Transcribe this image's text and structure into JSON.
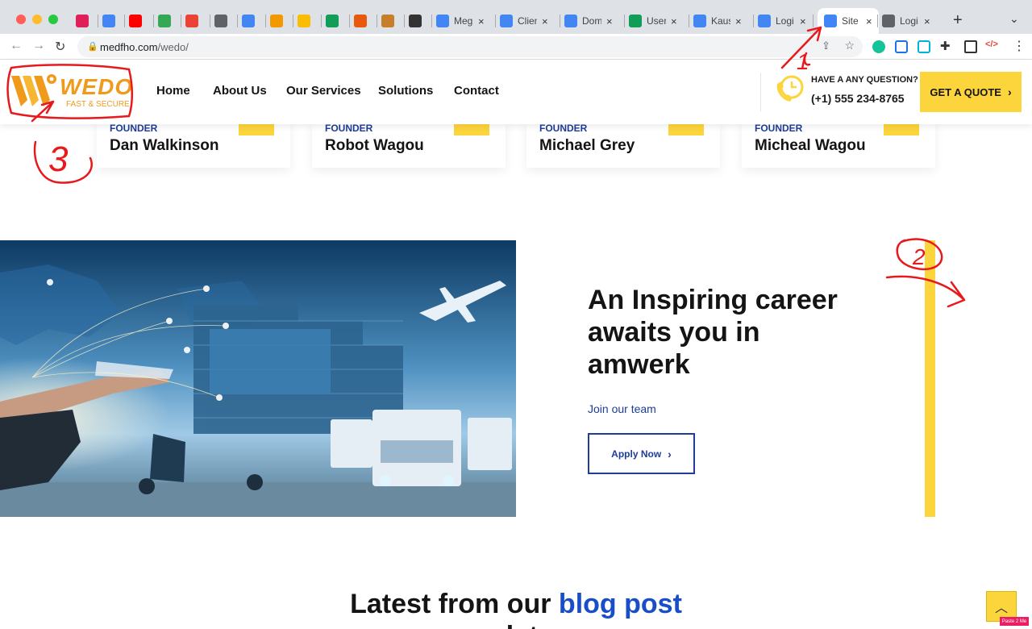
{
  "browser": {
    "tabs": [
      {
        "label": "",
        "icon": "slack-icon",
        "color": "#e01e5a"
      },
      {
        "label": "",
        "icon": "docs-icon",
        "color": "#4285f4"
      },
      {
        "label": "",
        "icon": "youtube-icon",
        "color": "#ff0000"
      },
      {
        "label": "",
        "icon": "calendar-icon",
        "color": "#34a853"
      },
      {
        "label": "",
        "icon": "gmail-icon",
        "color": "#ea4335"
      },
      {
        "label": "",
        "icon": "app-icon",
        "color": "#5f6368"
      },
      {
        "label": "",
        "icon": "docs-icon",
        "color": "#4285f4"
      },
      {
        "label": "",
        "icon": "app-icon",
        "color": "#f29900"
      },
      {
        "label": "",
        "icon": "slides-icon",
        "color": "#fbbc04"
      },
      {
        "label": "",
        "icon": "tasks-icon",
        "color": "#0f9d58"
      },
      {
        "label": "",
        "icon": "app-icon",
        "color": "#e8590c"
      },
      {
        "label": "",
        "icon": "app-icon",
        "color": "#c77d2a"
      },
      {
        "label": "",
        "icon": "app-icon",
        "color": "#333333"
      },
      {
        "label": "Meg",
        "icon": "docs-icon",
        "color": "#4285f4"
      },
      {
        "label": "Clien",
        "icon": "docs-icon",
        "color": "#4285f4"
      },
      {
        "label": "Dom",
        "icon": "docs-icon",
        "color": "#4285f4"
      },
      {
        "label": "User",
        "icon": "sheets-icon",
        "color": "#0f9d58"
      },
      {
        "label": "Kaus",
        "icon": "docs-icon",
        "color": "#4285f4"
      },
      {
        "label": "Logi",
        "icon": "google-sites-icon",
        "color": "#4285f4"
      },
      {
        "label": "Site",
        "icon": "google-sites-icon",
        "color": "#4285f4"
      },
      {
        "label": "Logi",
        "icon": "globe-icon",
        "color": "#5f6368"
      }
    ],
    "url_host": "medfho.com",
    "url_path": "/wedo/"
  },
  "header": {
    "logo_text": "WEDO",
    "logo_tagline": "FAST & SECURE",
    "nav": [
      "Home",
      "About Us",
      "Our Services",
      "Solutions",
      "Contact"
    ],
    "question_label": "HAVE A ANY QUESTION?",
    "phone": "(+1) 555 234-8765",
    "quote_label": "GET A QUOTE",
    "accent": "#fcd43b"
  },
  "team": [
    {
      "role": "FOUNDER",
      "name": "Dan Walkinson"
    },
    {
      "role": "FOUNDER",
      "name": "Robot Wagou"
    },
    {
      "role": "FOUNDER",
      "name": "Michael Grey"
    },
    {
      "role": "FOUNDER",
      "name": "Micheal Wagou"
    }
  ],
  "career": {
    "title": "An Inspiring career awaits you in amwerk",
    "join": "Join our team",
    "apply": "Apply Now"
  },
  "blog": {
    "heading_plain": "Latest from our",
    "heading_highlight": "blog post",
    "heading_second_line": "updates"
  },
  "annotations": [
    "1",
    "2",
    "3"
  ],
  "badge": "Paste 2 Me"
}
